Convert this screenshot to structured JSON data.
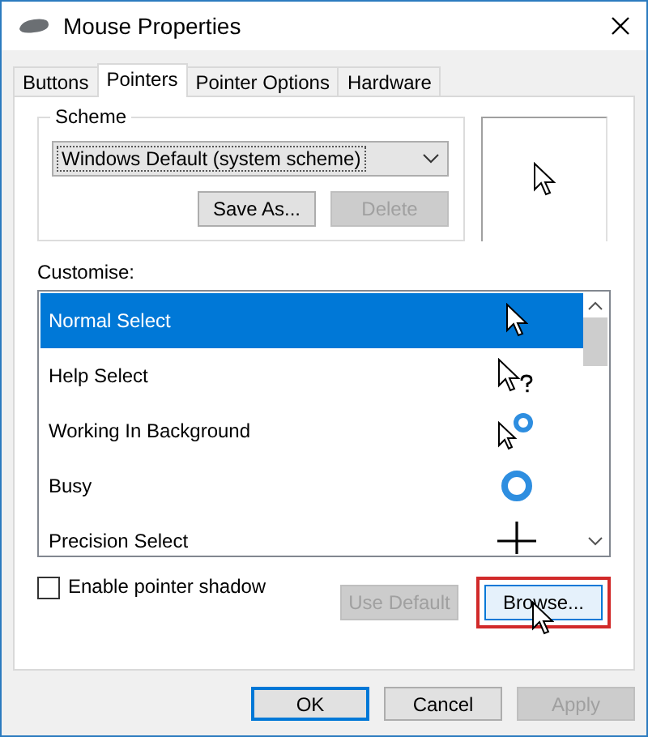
{
  "window": {
    "title": "Mouse Properties"
  },
  "tabs": [
    {
      "label": "Buttons",
      "selected": false
    },
    {
      "label": "Pointers",
      "selected": true
    },
    {
      "label": "Pointer Options",
      "selected": false
    },
    {
      "label": "Hardware",
      "selected": false
    }
  ],
  "scheme": {
    "label": "Scheme",
    "value": "Windows Default (system scheme)",
    "buttons": [
      {
        "label": "Save As...",
        "disabled": false
      },
      {
        "label": "Delete",
        "disabled": true
      }
    ]
  },
  "customise": {
    "label": "Customise:",
    "items": [
      {
        "label": "Normal Select",
        "kind": "arrow",
        "selected": true
      },
      {
        "label": "Help Select",
        "kind": "help",
        "selected": false
      },
      {
        "label": "Working In Background",
        "kind": "working",
        "selected": false
      },
      {
        "label": "Busy",
        "kind": "busy",
        "selected": false
      },
      {
        "label": "Precision Select",
        "kind": "precision",
        "selected": false
      }
    ]
  },
  "shadow": {
    "label": "Enable pointer shadow",
    "checked": false
  },
  "list_buttons": [
    {
      "label": "Use Default",
      "disabled": true,
      "highlighted": false
    },
    {
      "label": "Browse...",
      "disabled": false,
      "highlighted": true
    }
  ],
  "buttons": [
    {
      "label": "OK",
      "disabled": false,
      "default": true
    },
    {
      "label": "Cancel",
      "disabled": false,
      "default": false
    },
    {
      "label": "Apply",
      "disabled": true,
      "default": false
    }
  ]
}
